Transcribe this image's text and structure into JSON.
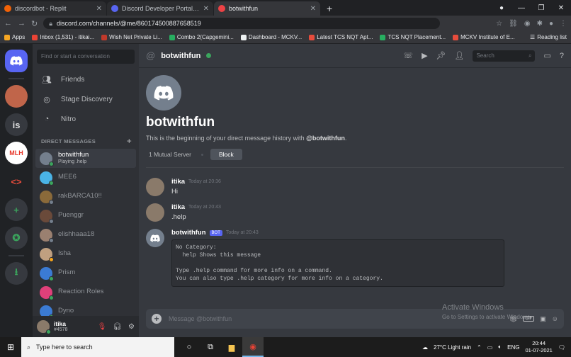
{
  "browser": {
    "tabs": [
      {
        "label": "discordbot - Replit",
        "color": "#f26207"
      },
      {
        "label": "Discord Developer Portal — My A",
        "color": "#5865f2"
      },
      {
        "label": "botwithfun",
        "color": "#ed4245"
      }
    ],
    "url": "discord.com/channels/@me/860174500887658519",
    "bookmarks": [
      "Apps",
      "Inbox (1,531) - itikai...",
      "Wish Net Private Li...",
      "Combo 2(Capgemini...",
      "Dashboard - MCKV...",
      "Latest TCS NQT Apt...",
      "TCS NQT Placement...",
      "MCKV Institute of E..."
    ],
    "reading_list": "Reading list"
  },
  "servers": [
    "is"
  ],
  "sidebar": {
    "search_placeholder": "Find or start a conversation",
    "nav": [
      {
        "label": "Friends",
        "icon": "friends-icon"
      },
      {
        "label": "Stage Discovery",
        "icon": "stage-icon"
      },
      {
        "label": "Nitro",
        "icon": "nitro-icon"
      }
    ],
    "dm_header": "DIRECT MESSAGES",
    "dms": [
      {
        "name": "botwithfun",
        "sub": "Playing .help",
        "color": "#747f8d",
        "status": "#3ba55d"
      },
      {
        "name": "MEE6",
        "sub": "",
        "color": "#4ab3e6",
        "status": "#3ba55d"
      },
      {
        "name": "rakBARCA10!!",
        "sub": "",
        "color": "#8a6a3a",
        "status": "#747f8d"
      },
      {
        "name": "Puengɡr",
        "sub": "",
        "color": "#6a4a3a",
        "status": "#747f8d"
      },
      {
        "name": "elishhaaa18",
        "sub": "",
        "color": "#9a8070",
        "status": "#747f8d"
      },
      {
        "name": "Isha",
        "sub": "",
        "color": "#c0a080",
        "status": "#faa61a"
      },
      {
        "name": "Prism",
        "sub": "",
        "color": "#3b7bd4",
        "status": "#3ba55d"
      },
      {
        "name": "Reaction Roles",
        "sub": "",
        "color": "#e0407a",
        "status": "#3ba55d"
      },
      {
        "name": "Dyno",
        "sub": "",
        "color": "#3b7bd4",
        "status": "#3ba55d"
      }
    ]
  },
  "user": {
    "name": "itika",
    "tag": "#4578"
  },
  "channel": {
    "name": "botwithfun",
    "search_placeholder": "Search",
    "intro_name": "botwithfun",
    "intro_text": "This is the beginning of your direct message history with",
    "intro_handle": "@botwithfun",
    "mutual": "1 Mutual Server",
    "block": "Block"
  },
  "messages": [
    {
      "author": "itika",
      "time": "Today at 20:36",
      "text": "Hi"
    },
    {
      "author": "itika",
      "time": "Today at 20:43",
      "text": ".help"
    },
    {
      "author": "botwithfun",
      "badge": "BOT",
      "time": "Today at 20:43",
      "code": "No Category:\n  help Shows this message\n\nType .help command for more info on a command.\nYou can also type .help category for more info on a category."
    }
  ],
  "composer": {
    "placeholder": "Message @botwithfun"
  },
  "watermark": {
    "line1": "Activate Windows",
    "line2": "Go to Settings to activate Windows."
  },
  "taskbar": {
    "search": "Type here to search",
    "weather": "27°C  Light rain",
    "lang": "ENG",
    "time": "20:44",
    "date": "01-07-2021"
  }
}
